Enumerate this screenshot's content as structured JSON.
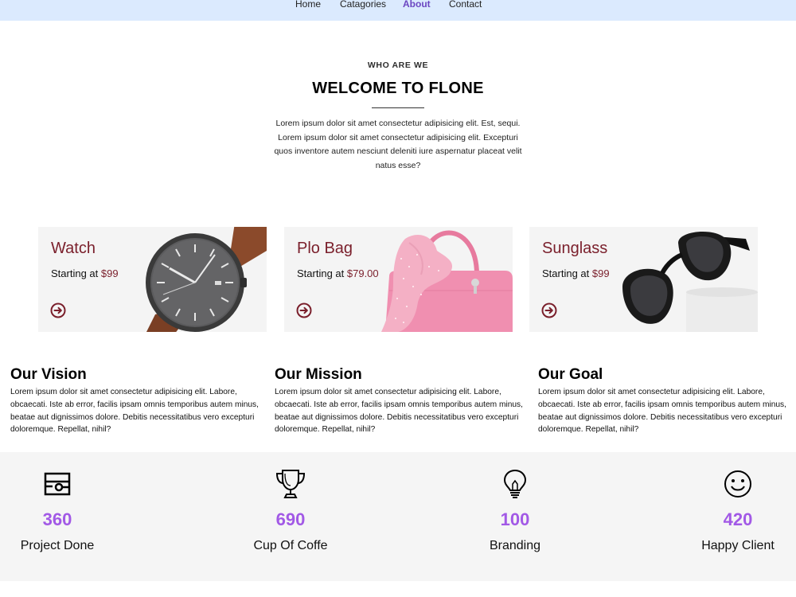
{
  "nav": {
    "items": [
      {
        "label": "Home",
        "active": false
      },
      {
        "label": "Catagories",
        "active": false
      },
      {
        "label": "About",
        "active": true
      },
      {
        "label": "Contact",
        "active": false
      }
    ]
  },
  "intro": {
    "eyebrow": "WHO ARE WE",
    "title": "WELCOME TO FLONE",
    "text": "Lorem ipsum dolor sit amet consectetur adipisicing elit. Est, sequi. Lorem ipsum dolor sit amet consectetur adipisicing elit. Excepturi quos inventore autem nesciunt deleniti iure aspernatur placeat velit natus esse?"
  },
  "cards": [
    {
      "title": "Watch",
      "price_prefix": "Starting at ",
      "price": "$99",
      "icon": "arrow-circle-right-icon"
    },
    {
      "title": "Plo Bag",
      "price_prefix": "Starting at ",
      "price": "$79.00",
      "icon": "arrow-circle-right-icon"
    },
    {
      "title": "Sunglass",
      "price_prefix": "Starting at ",
      "price": "$99",
      "icon": "arrow-circle-right-icon"
    }
  ],
  "info": [
    {
      "heading": "Our Vision",
      "text": "Lorem ipsum dolor sit amet consectetur adipisicing elit. Labore, obcaecati. Iste ab error, facilis ipsam omnis temporibus autem minus, beatae aut dignissimos dolore. Debitis necessitatibus vero excepturi doloremque. Repellat, nihil?"
    },
    {
      "heading": "Our Mission",
      "text": "Lorem ipsum dolor sit amet consectetur adipisicing elit. Labore, obcaecati. Iste ab error, facilis ipsam omnis temporibus autem minus, beatae aut dignissimos dolore. Debitis necessitatibus vero excepturi doloremque. Repellat, nihil?"
    },
    {
      "heading": "Our Goal",
      "text": "Lorem ipsum dolor sit amet consectetur adipisicing elit. Labore, obcaecati. Iste ab error, facilis ipsam omnis temporibus autem minus, beatae aut dignissimos dolore. Debitis necessitatibus vero excepturi doloremque. Repellat, nihil?"
    }
  ],
  "stats": [
    {
      "number": "360",
      "label": "Project Done",
      "icon": "project-icon"
    },
    {
      "number": "690",
      "label": "Cup Of Coffe",
      "icon": "trophy-icon"
    },
    {
      "number": "100",
      "label": "Branding",
      "icon": "lightbulb-icon"
    },
    {
      "number": "420",
      "label": "Happy Client",
      "icon": "smiley-icon"
    }
  ],
  "colors": {
    "nav_bg": "#dbeafe",
    "nav_active": "#6b46c1",
    "card_accent": "#7a1f2b",
    "stat_number": "#a259e6",
    "stats_bg": "#f5f5f5"
  }
}
